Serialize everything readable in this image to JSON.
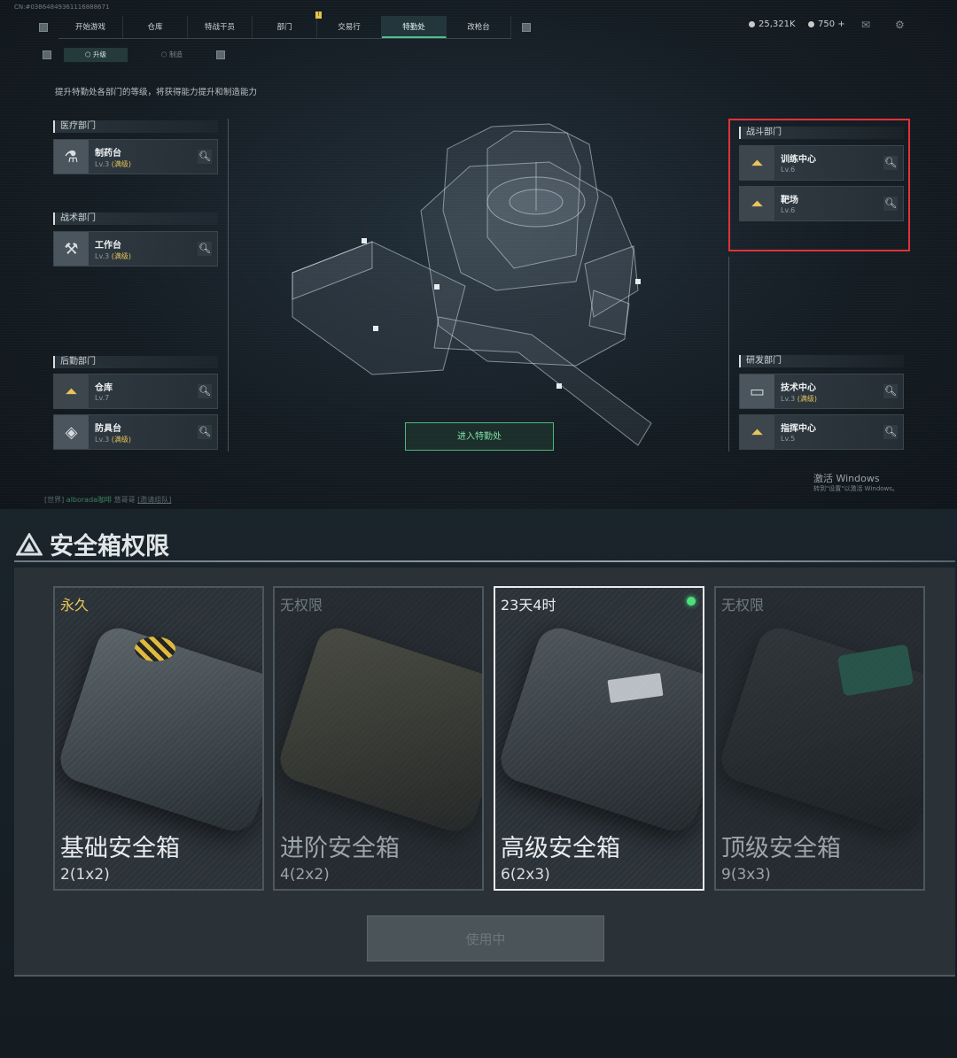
{
  "top": {
    "uid": "CN:#03864849361116888671",
    "nav_tabs": [
      {
        "label": "开始游戏"
      },
      {
        "label": "仓库"
      },
      {
        "label": "特战干员"
      },
      {
        "label": "部门"
      },
      {
        "label": "交易行"
      },
      {
        "label": "特勤处"
      },
      {
        "label": "改枪台"
      }
    ],
    "currency": {
      "coins": "25,321K",
      "premium": "750 +"
    },
    "subtabs": [
      "升级",
      "制造"
    ],
    "description": "提升特勤处各部门的等级，将获得能力提升和制造能力",
    "departments": {
      "medical": {
        "label": "医疗部门",
        "items": [
          {
            "name": "制药台",
            "level": "Lv.3",
            "max": "(满级)"
          }
        ]
      },
      "tactical": {
        "label": "战术部门",
        "items": [
          {
            "name": "工作台",
            "level": "Lv.3",
            "max": "(满级)"
          }
        ]
      },
      "logistics": {
        "label": "后勤部门",
        "items": [
          {
            "name": "仓库",
            "level": "Lv.7",
            "max": ""
          },
          {
            "name": "防具台",
            "level": "Lv.3",
            "max": "(满级)"
          }
        ]
      },
      "combat": {
        "label": "战斗部门",
        "items": [
          {
            "name": "训练中心",
            "level": "Lv.6",
            "max": ""
          },
          {
            "name": "靶场",
            "level": "Lv.6",
            "max": ""
          }
        ]
      },
      "research": {
        "label": "研发部门",
        "items": [
          {
            "name": "技术中心",
            "level": "Lv.3",
            "max": "(满级)"
          },
          {
            "name": "指挥中心",
            "level": "Lv.5",
            "max": ""
          }
        ]
      }
    },
    "enter_button": "进入特勤处",
    "windows_activate": "激活 Windows",
    "windows_activate_sub": "转到\"设置\"以激活 Windows。",
    "chat": {
      "channel": "[世界]",
      "user": "alborada咖啡",
      "message": "悠哥哥",
      "link": "[邀请组队]"
    }
  },
  "safebox": {
    "title": "安全箱权限",
    "boxes": [
      {
        "status": "永久",
        "name": "基础安全箱",
        "size": "2(1x2)"
      },
      {
        "status": "无权限",
        "name": "进阶安全箱",
        "size": "4(2x2)"
      },
      {
        "status": "23天4时",
        "name": "高级安全箱",
        "size": "6(2x3)"
      },
      {
        "status": "无权限",
        "name": "顶级安全箱",
        "size": "9(3x3)"
      }
    ],
    "use_button": "使用中"
  },
  "colors": {
    "accent_green": "#4fc08d",
    "highlight_red": "#e0323a",
    "gold": "#e4c657"
  }
}
